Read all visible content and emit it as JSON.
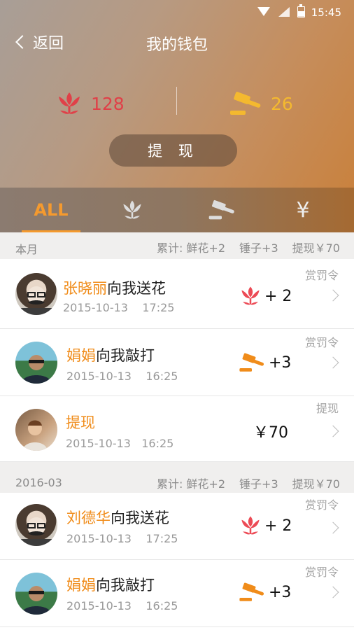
{
  "status": {
    "time": "15:45"
  },
  "nav": {
    "back_label": "返回",
    "title": "我的钱包"
  },
  "stats": {
    "flowers": "128",
    "hammers": "26"
  },
  "withdraw_label": "提 现",
  "tabs": [
    {
      "label": "ALL",
      "icon": ""
    },
    {
      "label": "",
      "icon": "flower-icon"
    },
    {
      "label": "",
      "icon": "hammer-icon"
    },
    {
      "label": "¥",
      "icon": "yuan-icon"
    }
  ],
  "sections": [
    {
      "title": "本月",
      "summary": {
        "total": "累计: 鲜花+2",
        "hammer": "锤子+3",
        "withdraw": "提现￥70"
      },
      "rows": [
        {
          "name": "张晓丽",
          "action": "向我送花",
          "date": "2015-10-13    17:25",
          "tag": "赏罚令",
          "amount": "+ 2"
        },
        {
          "name": "娟娟",
          "action": "向我敲打",
          "date": "2015-10-13    16:25",
          "tag": "赏罚令",
          "amount": "+3"
        },
        {
          "name": "提现",
          "action": "",
          "date": "2015-10-13   16:25",
          "tag": "提现",
          "amount": "￥70"
        }
      ]
    },
    {
      "title": "2016-03",
      "summary": {
        "total": "累计: 鲜花+2",
        "hammer": "锤子+3",
        "withdraw": "提现￥70"
      },
      "rows": [
        {
          "name": "刘德华",
          "action": "向我送花",
          "date": "2015-10-13    17:25",
          "tag": "赏罚令",
          "amount": "+ 2"
        },
        {
          "name": "娟娟",
          "action": "向我敲打",
          "date": "2015-10-13    16:25",
          "tag": "赏罚令",
          "amount": "+3"
        }
      ]
    }
  ],
  "colors": {
    "accent": "#f08c1a",
    "flower": "#e04048",
    "hammer": "#f4b92f"
  }
}
